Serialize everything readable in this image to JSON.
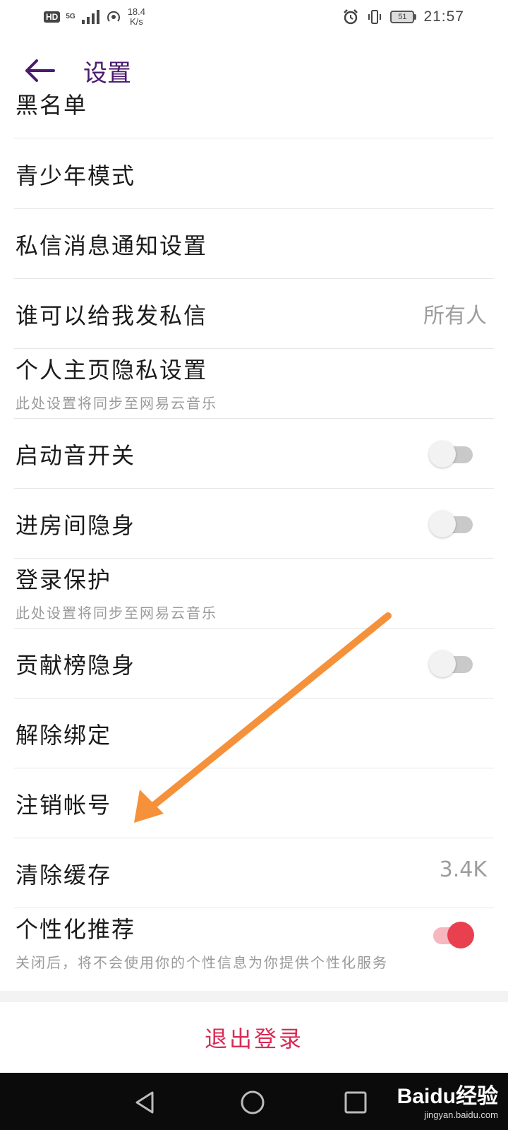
{
  "status_bar": {
    "hd": "HD",
    "network": "5G",
    "speed_value": "18.4",
    "speed_unit": "K/s",
    "battery": "51",
    "time": "21:57"
  },
  "header": {
    "title": "设置"
  },
  "settings": [
    {
      "label": "黑名单"
    },
    {
      "label": "青少年模式"
    },
    {
      "label": "私信消息通知设置"
    },
    {
      "label": "谁可以给我发私信",
      "value": "所有人"
    },
    {
      "label": "个人主页隐私设置",
      "sub": "此处设置将同步至网易云音乐"
    },
    {
      "label": "启动音开关",
      "toggle": false
    },
    {
      "label": "进房间隐身",
      "toggle": false
    },
    {
      "label": "登录保护",
      "sub": "此处设置将同步至网易云音乐"
    },
    {
      "label": "贡献榜隐身",
      "toggle": false
    },
    {
      "label": "解除绑定"
    },
    {
      "label": "注销帐号"
    },
    {
      "label": "清除缓存",
      "value": "3.4K"
    },
    {
      "label": "个性化推荐",
      "sub": "关闭后，将不会使用你的个性信息为你提供个性化服务",
      "toggle": true
    }
  ],
  "logout": {
    "label": "退出登录"
  },
  "watermark": {
    "brand": "Baidu经验",
    "url": "jingyan.baidu.com"
  },
  "colors": {
    "title": "#4a1a6e",
    "logout": "#d92c55",
    "toggle_on": "#e8404e",
    "annotation_arrow": "#f5913a"
  },
  "icons": [
    "back-arrow-icon",
    "nav-back-icon",
    "nav-home-icon",
    "nav-recents-icon"
  ]
}
